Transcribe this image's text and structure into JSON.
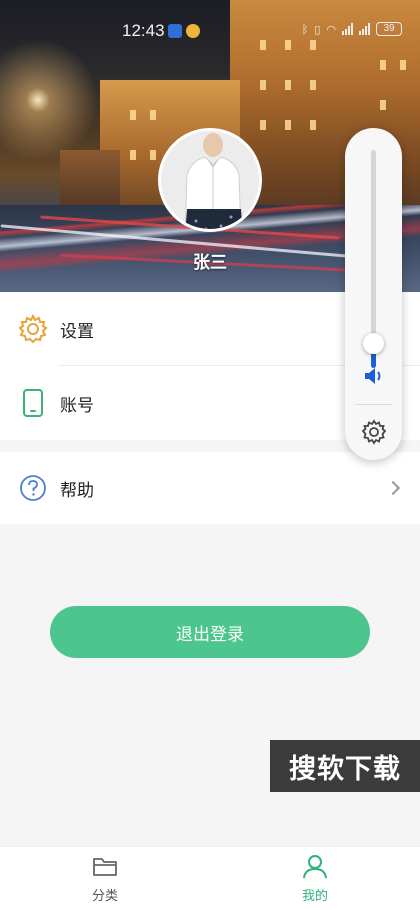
{
  "status_bar": {
    "time": "12:43",
    "battery": "39"
  },
  "profile": {
    "username": "张三"
  },
  "menu": {
    "items": [
      {
        "label": "设置",
        "icon": "gear-icon",
        "color": "#e8a23a"
      },
      {
        "label": "账号",
        "icon": "phone-icon",
        "color": "#3cb371"
      },
      {
        "label": "帮助",
        "icon": "help-circle-icon",
        "color": "#4a7fc9"
      }
    ]
  },
  "logout": {
    "label": "退出登录",
    "color": "#4cc58f"
  },
  "volume": {
    "level": 0.07,
    "accent": "#1d5fd6"
  },
  "watermark": {
    "text": "搜软下载"
  },
  "bottom_nav": {
    "tabs": [
      {
        "label": "分类",
        "icon": "folder-icon",
        "active": false
      },
      {
        "label": "我的",
        "icon": "person-icon",
        "active": true,
        "color": "#2db37a"
      }
    ]
  }
}
